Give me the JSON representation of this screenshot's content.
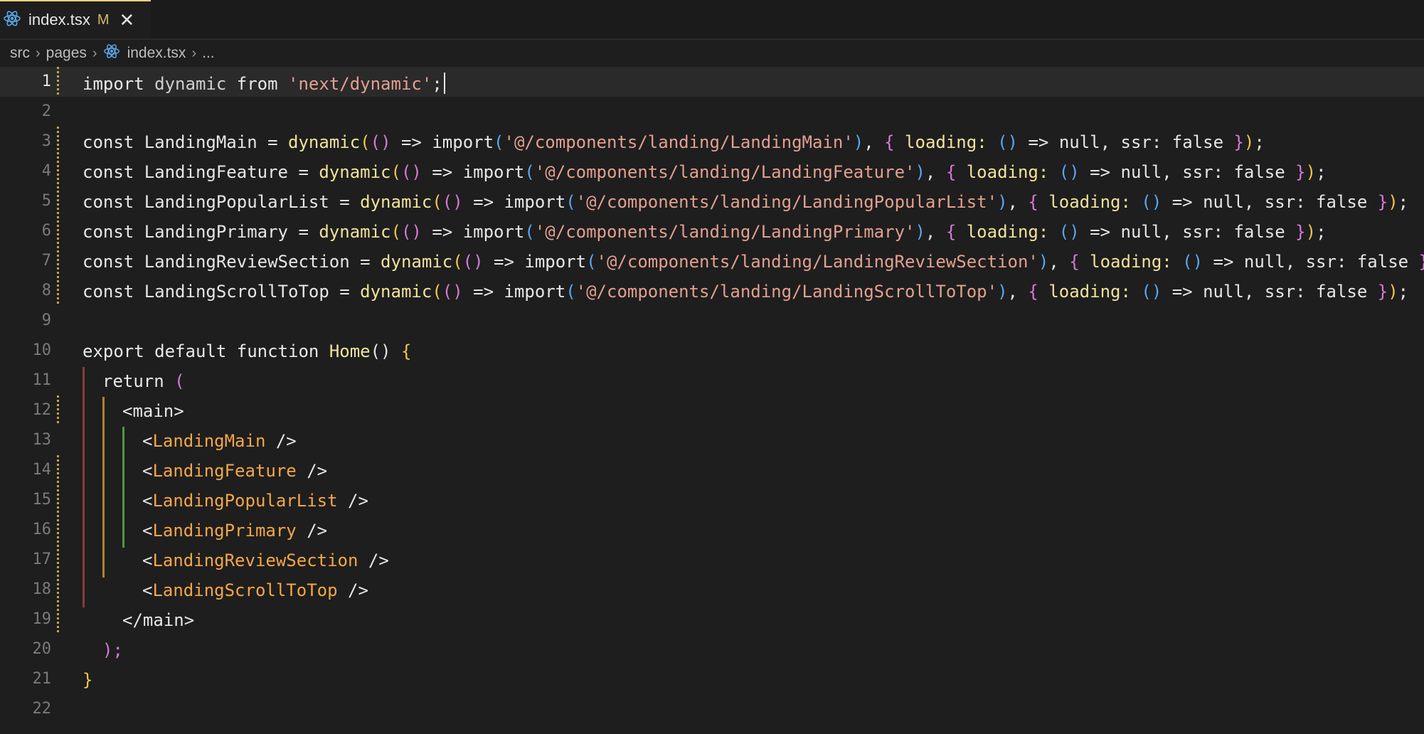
{
  "tab": {
    "title": "index.tsx",
    "status": "M",
    "close_glyph": "✕",
    "icon": "react-icon"
  },
  "breadcrumb": {
    "items": [
      "src",
      "pages",
      "index.tsx",
      "..."
    ],
    "separator": "›",
    "file_icon": "react-icon"
  },
  "editor": {
    "current_line": 1,
    "line_numbers": [
      "1",
      "2",
      "3",
      "4",
      "5",
      "6",
      "7",
      "8",
      "9",
      "10",
      "11",
      "12",
      "13",
      "14",
      "15",
      "16",
      "17",
      "18",
      "19",
      "20",
      "21",
      "22"
    ],
    "import_line": {
      "kw1": "import",
      "name": "dynamic",
      "kw2": "from",
      "module": "'next/dynamic'",
      "end": ";"
    },
    "dynamic_imports": [
      {
        "name": "LandingMain",
        "path": "'@/components/landing/LandingMain'"
      },
      {
        "name": "LandingFeature",
        "path": "'@/components/landing/LandingFeature'"
      },
      {
        "name": "LandingPopularList",
        "path": "'@/components/landing/LandingPopularList'"
      },
      {
        "name": "LandingPrimary",
        "path": "'@/components/landing/LandingPrimary'"
      },
      {
        "name": "LandingReviewSection",
        "path": "'@/components/landing/LandingReviewSection'"
      },
      {
        "name": "LandingScrollToTop",
        "path": "'@/components/landing/LandingScrollToTop'"
      }
    ],
    "tokens": {
      "const": "const",
      "equals": "=",
      "dynamic": "dynamic",
      "arrow": "=>",
      "import": "import",
      "loading": "loading:",
      "null": "null,",
      "ssr": "ssr:",
      "false": "false"
    },
    "export_line": {
      "kw1": "export",
      "kw2": "default",
      "kw3": "function",
      "name": "Home",
      "parens": "()",
      "brace": "{"
    },
    "return_line": {
      "kw": "return",
      "paren": "("
    },
    "main_open": "main",
    "jsx_children": [
      "LandingMain",
      "LandingFeature",
      "LandingPopularList",
      "LandingPrimary",
      "LandingReviewSection",
      "LandingScrollToTop"
    ],
    "main_close": "main",
    "close_paren": ");",
    "close_brace": "}"
  }
}
